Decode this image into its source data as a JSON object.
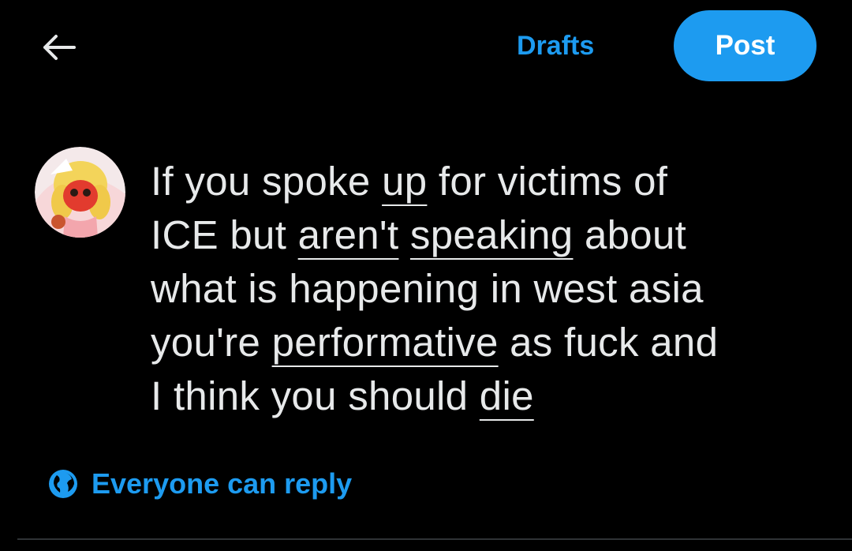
{
  "header": {
    "back_icon": "arrow-left-icon",
    "drafts_label": "Drafts",
    "post_label": "Post"
  },
  "composer": {
    "avatar_icon": "user-avatar",
    "segments": [
      {
        "text": "If you spoke ",
        "underline": false
      },
      {
        "text": "up",
        "underline": true
      },
      {
        "text": " for victims of\nICE but ",
        "underline": false
      },
      {
        "text": "aren't",
        "underline": true
      },
      {
        "text": " ",
        "underline": false
      },
      {
        "text": "speaking",
        "underline": true
      },
      {
        "text": " about\nwhat is happening in west asia\nyou're ",
        "underline": false
      },
      {
        "text": "performative",
        "underline": true
      },
      {
        "text": " as fuck and\nI think you should ",
        "underline": false
      },
      {
        "text": "die",
        "underline": true
      }
    ]
  },
  "reply_setting": {
    "icon": "globe-icon",
    "label": "Everyone can reply"
  },
  "colors": {
    "background": "#000000",
    "text": "#e7e9ea",
    "accent": "#1d9bf0",
    "divider": "#2f3336"
  }
}
